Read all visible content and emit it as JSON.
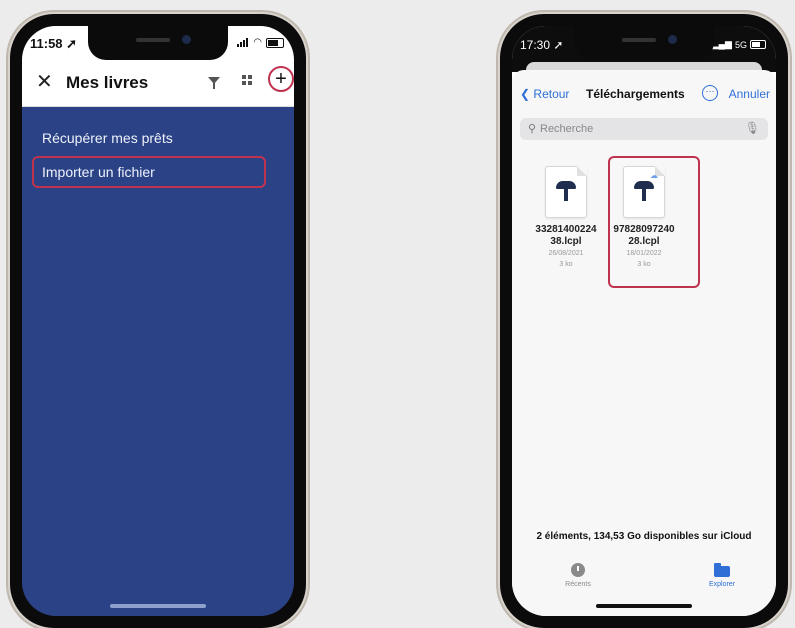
{
  "left_phone": {
    "status": {
      "time": "11:58 ➚"
    },
    "navbar": {
      "close_glyph": "✕",
      "title": "Mes livres",
      "add_glyph": "+"
    },
    "menu": {
      "items": [
        "Récupérer mes prêts",
        "Importer un fichier"
      ]
    },
    "colors": {
      "background": "#2b4386",
      "highlight": "#c0334f"
    }
  },
  "right_phone": {
    "status": {
      "time": "17:30 ➚",
      "network": "5G"
    },
    "navbar": {
      "back_label": "Retour",
      "title": "Téléchargements",
      "more_glyph": "⋯",
      "cancel_label": "Annuler"
    },
    "search": {
      "placeholder": "Recherche"
    },
    "files": [
      {
        "name_line1": "33281400224",
        "name_line2": "38.lcpl",
        "date": "26/08/2021",
        "size": "3 ko"
      },
      {
        "name_line1": "97828097240",
        "name_line2": "28.lcpl",
        "date": "18/01/2022",
        "size": "3 ko"
      }
    ],
    "footer": {
      "summary": "2 éléments, 134,53 Go disponibles sur iCloud"
    },
    "tabs": [
      {
        "label": "Récents",
        "icon": "clock-icon",
        "color": "#8a8a8a"
      },
      {
        "label": "Explorer",
        "icon": "folder-icon",
        "color": "#2f6fd6"
      }
    ],
    "colors": {
      "accent": "#2f6fd6",
      "highlight": "#c0334f"
    }
  }
}
